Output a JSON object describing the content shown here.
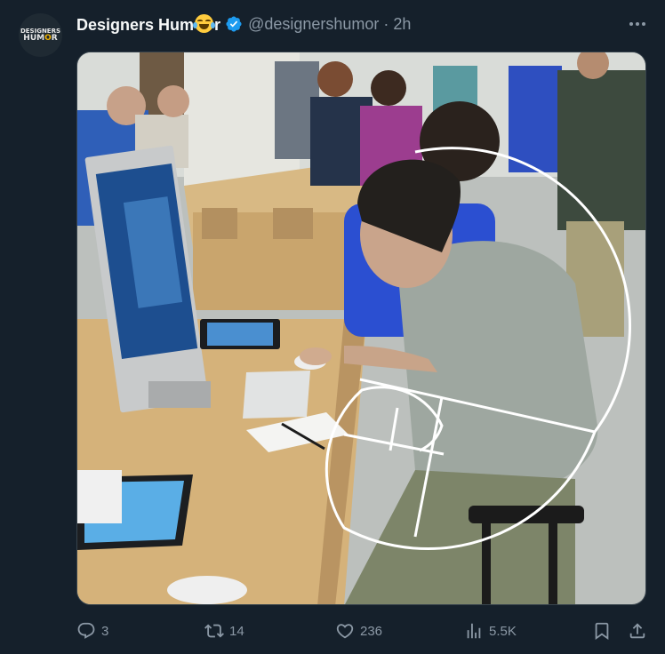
{
  "tweet": {
    "avatar": {
      "line1": "DESIGNERS",
      "line2a": "HUM",
      "line2b": "O",
      "line2c": "R"
    },
    "display_name_a": "Designers Hum",
    "display_name_b": "r",
    "handle": "@designershumor",
    "separator": "·",
    "time": "2h",
    "verified_color": "#1d9bf0"
  },
  "actions": {
    "replies": "3",
    "retweets": "14",
    "likes": "236",
    "views": "5.5K"
  },
  "colors": {
    "background": "#15202b",
    "text": "#f7f9f9",
    "muted": "#8b98a5",
    "accent": "#1d9bf0"
  },
  "icons": [
    "more-icon",
    "reply-icon",
    "retweet-icon",
    "like-icon",
    "views-icon",
    "bookmark-icon",
    "share-icon"
  ]
}
